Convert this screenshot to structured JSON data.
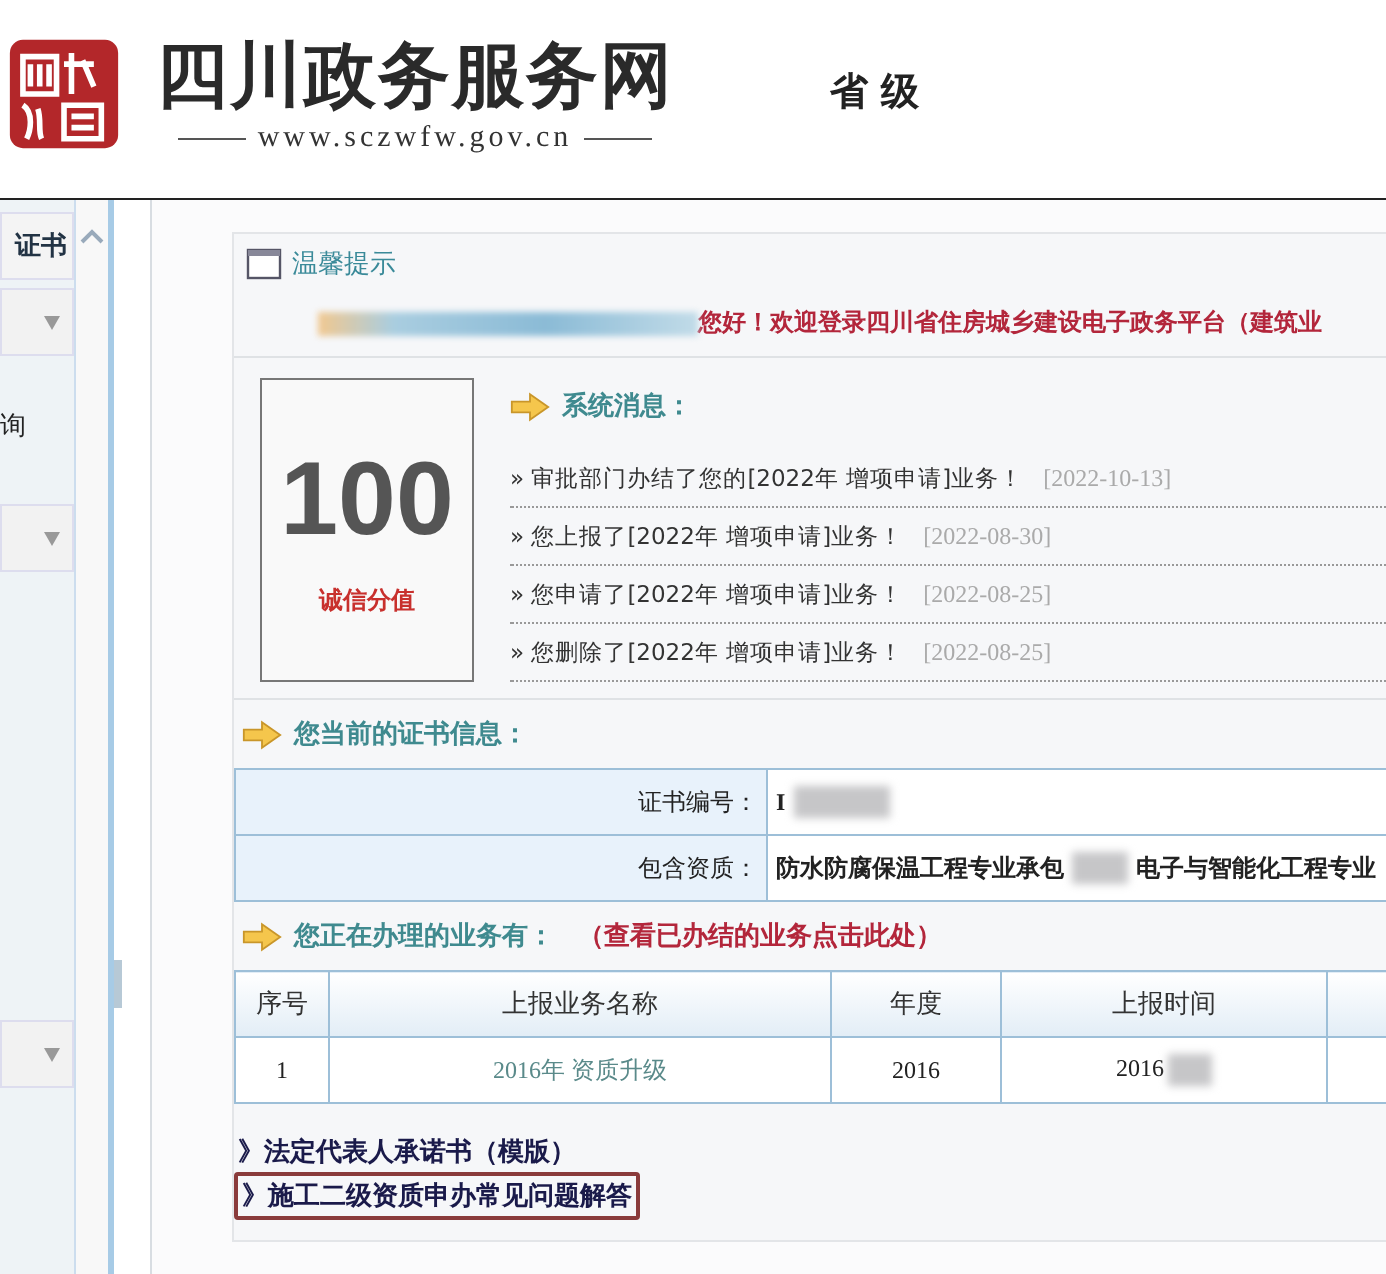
{
  "header": {
    "site_title": "四川政务服务网",
    "site_url": "www.sczwfw.gov.cn",
    "level": "省 级"
  },
  "sidebar": {
    "items": [
      {
        "kind": "header",
        "label": "证书"
      },
      {
        "kind": "dropdown"
      },
      {
        "kind": "text",
        "label": "询"
      },
      {
        "kind": "dropdown"
      },
      {
        "kind": "spacer"
      },
      {
        "kind": "dropdown"
      }
    ]
  },
  "notice": {
    "title": "温馨提示",
    "greeting": "您好！欢迎登录四川省住房城乡建设电子政务平台（建筑业"
  },
  "score": {
    "value": "100",
    "label": "诚信分值"
  },
  "messages": {
    "title": "系统消息：",
    "items": [
      {
        "text": "» 审批部门办结了您的[2022年 增项申请]业务！",
        "date": "[2022-10-13]"
      },
      {
        "text": "» 您上报了[2022年 增项申请]业务！",
        "date": "[2022-08-30]"
      },
      {
        "text": "» 您申请了[2022年 增项申请]业务！",
        "date": "[2022-08-25]"
      },
      {
        "text": "» 您删除了[2022年 增项申请]业务！",
        "date": "[2022-08-25]"
      }
    ]
  },
  "certificate": {
    "title": "您当前的证书信息：",
    "rows": [
      {
        "label": "证书编号：",
        "values": [
          "I"
        ]
      },
      {
        "label": "包含资质：",
        "values": [
          "防水防腐保温工程专业承包",
          "电子与智能化工程专业"
        ]
      }
    ]
  },
  "business": {
    "title": "您正在办理的业务有：",
    "link": "（查看已办结的业务点击此处）",
    "table": {
      "columns": [
        "序号",
        "上报业务名称",
        "年度",
        "上报时间"
      ],
      "rows": [
        [
          "1",
          "2016年 资质升级",
          "2016",
          "2016"
        ]
      ]
    }
  },
  "links": [
    {
      "text": "》法定代表人承诺书（模版）",
      "highlighted": false
    },
    {
      "text": "》施工二级资质申办常见问题解答",
      "highlighted": true
    }
  ]
}
